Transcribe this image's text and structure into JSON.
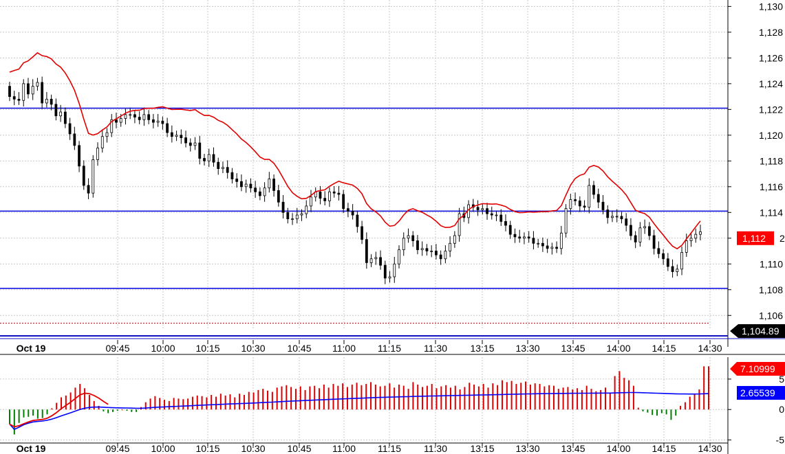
{
  "chart_data": [
    {
      "type": "candlestick",
      "panel": "price",
      "ylim": [
        1105,
        1130.5
      ],
      "ytick_values": [
        1106,
        1108,
        1110,
        1112,
        1114,
        1116,
        1118,
        1120,
        1122,
        1124,
        1126,
        1128,
        1130
      ],
      "ytick_labels": [
        "1,106",
        "1,108",
        "1,110",
        "",
        "1,114",
        "1,116",
        "1,118",
        "1,120",
        "1,122",
        "1,124",
        "1,126",
        "1,128",
        "1,130"
      ],
      "xtick_labels": [
        "Oct 19",
        "09:45",
        "10:00",
        "10:15",
        "10:30",
        "10:45",
        "11:00",
        "11:15",
        "11:30",
        "13:15",
        "13:30",
        "13:45",
        "14:00",
        "14:15",
        "14:30"
      ],
      "grid": true,
      "horizontal_levels": [
        1122.1,
        1114.1,
        1108.1
      ],
      "dashed_level": 1105.4,
      "bar_count": 150,
      "close": [
        1123.0,
        1122.8,
        1122.7,
        1124.0,
        1123.2,
        1123.8,
        1124.1,
        1122.5,
        1122.8,
        1122.4,
        1121.5,
        1121.8,
        1120.9,
        1120.1,
        1119.2,
        1117.6,
        1116.1,
        1115.5,
        1118.1,
        1119.0,
        1119.9,
        1120.2,
        1121.2,
        1121.0,
        1121.3,
        1121.6,
        1121.6,
        1121.4,
        1121.2,
        1121.6,
        1121.2,
        1121.0,
        1121.1,
        1120.9,
        1120.2,
        1119.9,
        1120.0,
        1119.8,
        1119.4,
        1119.2,
        1119.4,
        1118.2,
        1118.0,
        1118.5,
        1117.9,
        1117.4,
        1117.5,
        1117.1,
        1116.6,
        1116.4,
        1116.0,
        1116.2,
        1115.9,
        1115.6,
        1115.3,
        1115.9,
        1116.6,
        1115.7,
        1114.8,
        1114.0,
        1113.5,
        1113.5,
        1113.8,
        1113.9,
        1114.5,
        1115.2,
        1115.6,
        1115.1,
        1114.9,
        1115.6,
        1115.5,
        1115.4,
        1114.3,
        1114.1,
        1113.8,
        1112.9,
        1111.9,
        1110.1,
        1110.4,
        1110.5,
        1109.9,
        1108.9,
        1109.0,
        1110.0,
        1111.1,
        1112.0,
        1112.2,
        1111.8,
        1111.1,
        1111.2,
        1111.0,
        1111.0,
        1110.7,
        1110.4,
        1111.0,
        1111.6,
        1112.2,
        1113.9,
        1113.6,
        1114.6,
        1114.4,
        1114.2,
        1114.3,
        1113.9,
        1113.8,
        1113.8,
        1113.3,
        1113.0,
        1112.3,
        1112.1,
        1112.0,
        1112.1,
        1112.0,
        1111.6,
        1111.6,
        1111.4,
        1111.2,
        1111.3,
        1111.2,
        1112.4,
        1114.3,
        1115.0,
        1114.9,
        1114.5,
        1114.4,
        1116.1,
        1115.4,
        1114.8,
        1114.2,
        1113.6,
        1113.7,
        1113.7,
        1113.5,
        1113.0,
        1112.2,
        1111.7,
        1112.8,
        1112.9,
        1112.2,
        1111.2,
        1110.8,
        1110.4,
        1109.8,
        1109.4,
        1109.6,
        1110.9,
        1111.8,
        1112.0,
        1112.3,
        1112.5
      ],
      "overlay_line": {
        "color": "#e00000"
      },
      "last_price_label": "1,112",
      "last_price_color": "#ff0000",
      "current_label": "1,104.89"
    },
    {
      "type": "histogram",
      "panel": "indicator",
      "ylim": [
        -5.5,
        8.6
      ],
      "ytick_values": [
        5,
        0,
        -5
      ],
      "ytick_labels": [
        "5",
        "0",
        "-5"
      ],
      "positive_color": "#dd0000",
      "negative_color": "#008000",
      "values": [
        -2.4,
        -4.1,
        -2.2,
        -1.3,
        -1.2,
        -1.0,
        -1.5,
        -1.4,
        -0.8,
        0.2,
        1.1,
        2.0,
        2.3,
        2.8,
        3.6,
        4.2,
        3.5,
        2.4,
        1.4,
        0.6,
        -0.3,
        -0.6,
        -0.4,
        -0.2,
        0.0,
        -0.2,
        -0.4,
        -0.4,
        0.4,
        1.2,
        1.8,
        2.2,
        1.9,
        1.6,
        1.4,
        1.9,
        1.8,
        1.7,
        1.8,
        2.1,
        2.3,
        2.2,
        2.0,
        2.4,
        2.1,
        2.6,
        2.3,
        2.5,
        2.0,
        2.6,
        2.4,
        2.9,
        2.8,
        3.2,
        3.4,
        3.1,
        2.9,
        3.6,
        3.8,
        4.0,
        3.7,
        3.4,
        3.8,
        3.2,
        3.8,
        3.9,
        3.5,
        4.1,
        3.6,
        4.2,
        3.9,
        4.3,
        3.7,
        4.1,
        4.4,
        4.0,
        4.2,
        4.5,
        4.1,
        3.8,
        3.9,
        4.3,
        3.6,
        4.1,
        3.9,
        3.4,
        4.5,
        4.1,
        3.7,
        3.9,
        4.2,
        3.5,
        3.8,
        4.0,
        3.6,
        3.9,
        3.3,
        3.7,
        4.4,
        4.1,
        3.8,
        4.2,
        3.6,
        4.3,
        4.0,
        4.8,
        4.5,
        4.7,
        4.2,
        4.4,
        4.6,
        4.1,
        4.3,
        4.2,
        3.8,
        4.0,
        3.9,
        3.4,
        3.6,
        3.7,
        3.3,
        3.5,
        3.2,
        3.9,
        3.4,
        3.0,
        3.2,
        3.6,
        2.8,
        5.5,
        6.3,
        5.2,
        4.8,
        3.9,
        0.3,
        -0.3,
        -0.5,
        -0.9,
        -1.0,
        -0.6,
        -0.8,
        -1.7,
        -1.0,
        0.6,
        1.2,
        2.1,
        2.6,
        3.3,
        7.1,
        7.1
      ],
      "signal_line": {
        "color": "#0000ff"
      },
      "overlay_line": {
        "color": "#e00000"
      },
      "value_label_1": "7.10999",
      "value_label_1_color": "#ff0000",
      "value_label_2": "2.65539",
      "value_label_2_color": "#0000ff",
      "xtick_labels": [
        "Oct 19",
        "09:45",
        "10:00",
        "10:15",
        "10:30",
        "10:45",
        "11:00",
        "11:15",
        "11:30",
        "13:15",
        "13:30",
        "13:45",
        "14:00",
        "14:15",
        "14:30"
      ]
    }
  ]
}
